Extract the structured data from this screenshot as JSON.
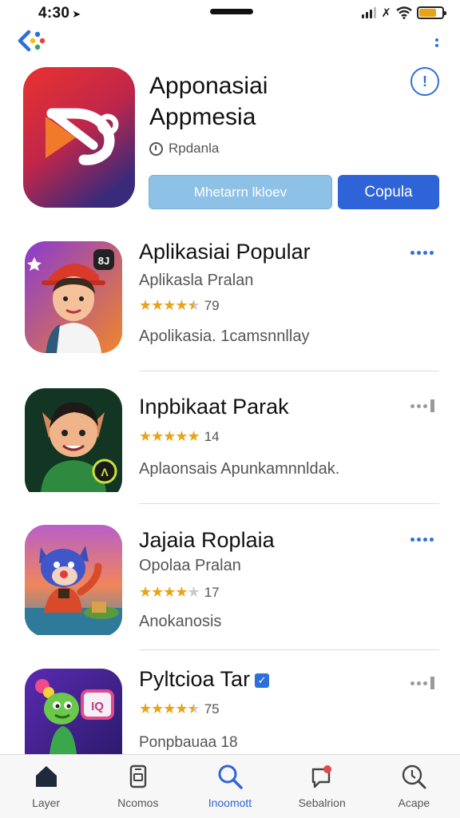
{
  "status": {
    "time": "4:30",
    "battery_level": 0.75
  },
  "header": {
    "title_line1": "Apponasiai",
    "title_line2": "Appmesia",
    "subtitle": "Rpdanla",
    "secondary_button": "Mhetarrn lkloev",
    "primary_button": "Copula",
    "info_icon": "info-icon"
  },
  "apps": [
    {
      "name": "Aplikasiai Popular",
      "subtitle": "Aplikasla Pralan",
      "stars": 4.5,
      "rating_count": "79",
      "description": "Apolikasia. 1camsnnllay",
      "more_style": "blue"
    },
    {
      "name": "Inpbikaat Parak",
      "subtitle": "",
      "stars": 5,
      "rating_count": "14",
      "description": "Aplaonsais Apunkamnnldak.",
      "more_style": "gray"
    },
    {
      "name": "Jajaia Roplaia",
      "subtitle": "Opolaa Pralan",
      "stars": 4,
      "rating_count": "17",
      "description": "Anokanosis",
      "more_style": "blue"
    },
    {
      "name": "Pyltcioa Tar",
      "subtitle": "",
      "stars": 4.5,
      "rating_count": "75",
      "description": "Ponpbauaa 18",
      "more_style": "gray"
    }
  ],
  "tabs": [
    {
      "label": "Layer",
      "icon": "home-icon",
      "active": false
    },
    {
      "label": "Ncomos",
      "icon": "apps-icon",
      "active": false
    },
    {
      "label": "Inoomott",
      "icon": "search-icon",
      "active": true
    },
    {
      "label": "Sebalrion",
      "icon": "notification-icon",
      "active": false
    },
    {
      "label": "Acape",
      "icon": "search-circle-icon",
      "active": false
    }
  ],
  "colors": {
    "accent": "#2f64d8",
    "star": "#e8a317",
    "secondary_button": "#8ec1e6"
  }
}
